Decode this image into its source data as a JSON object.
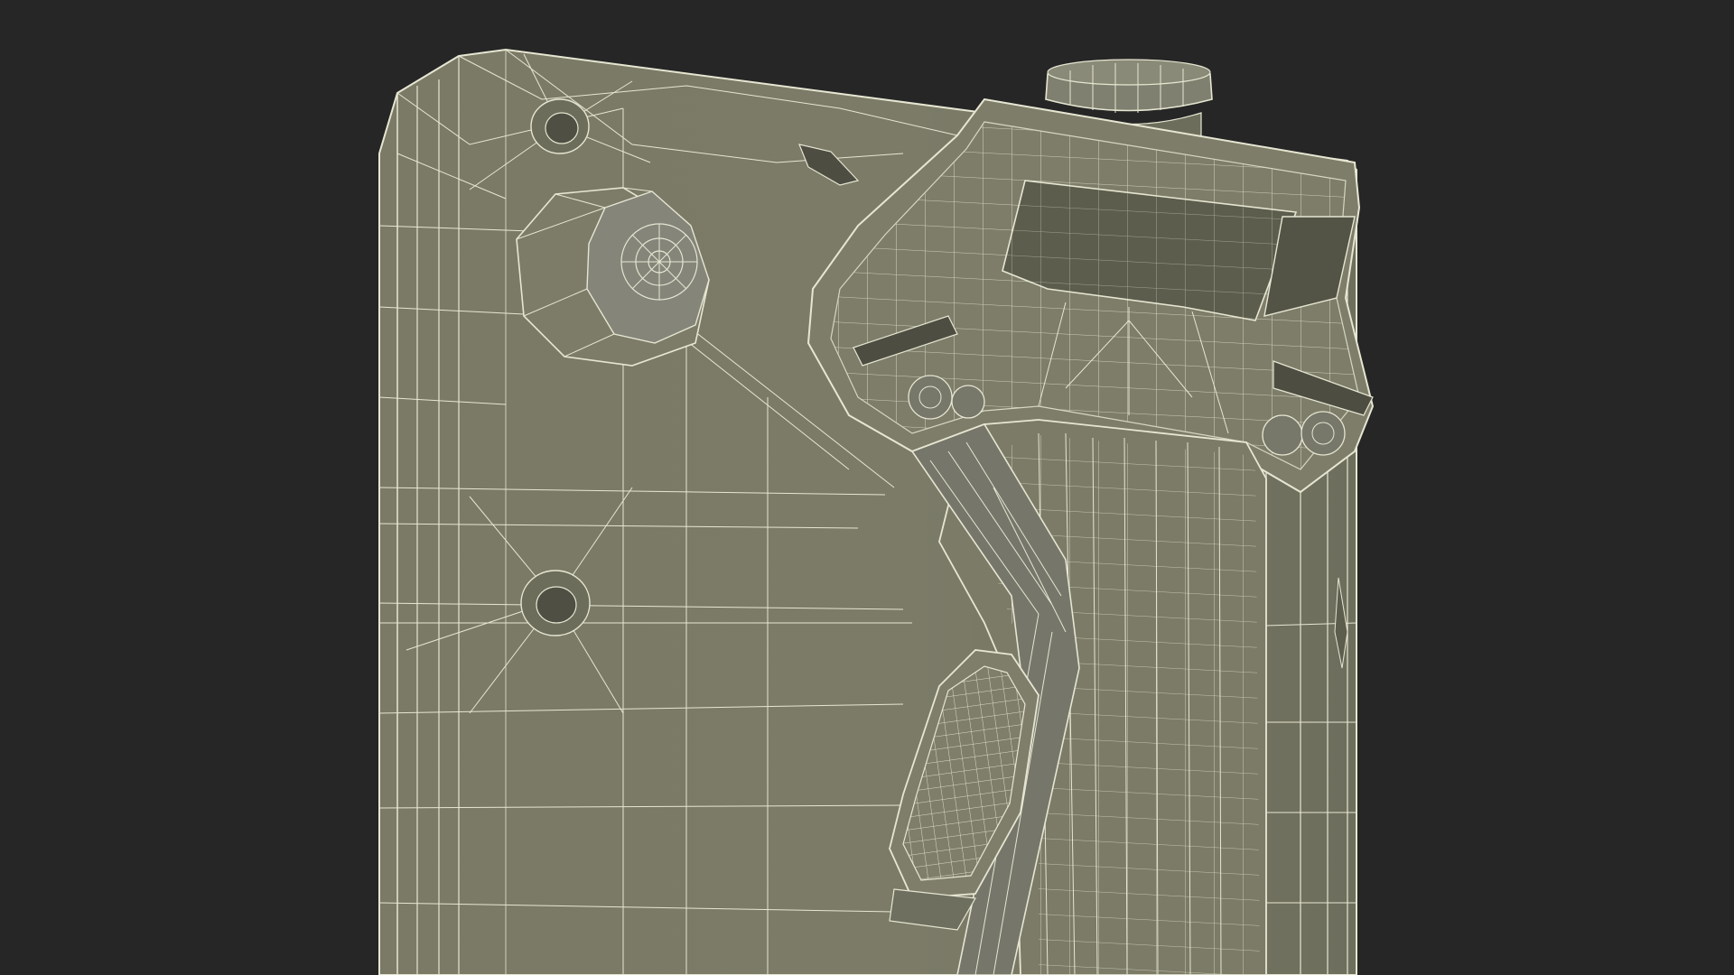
{
  "scene": {
    "subject": "wireframe-3d-model-render",
    "view": "perspective"
  },
  "colors": {
    "background": "#262626",
    "surface": "#7a7a67",
    "surface_light": "#8a8a76",
    "surface_dark": "#666656",
    "recess": "#585849",
    "wire": "#e6e6d2"
  }
}
